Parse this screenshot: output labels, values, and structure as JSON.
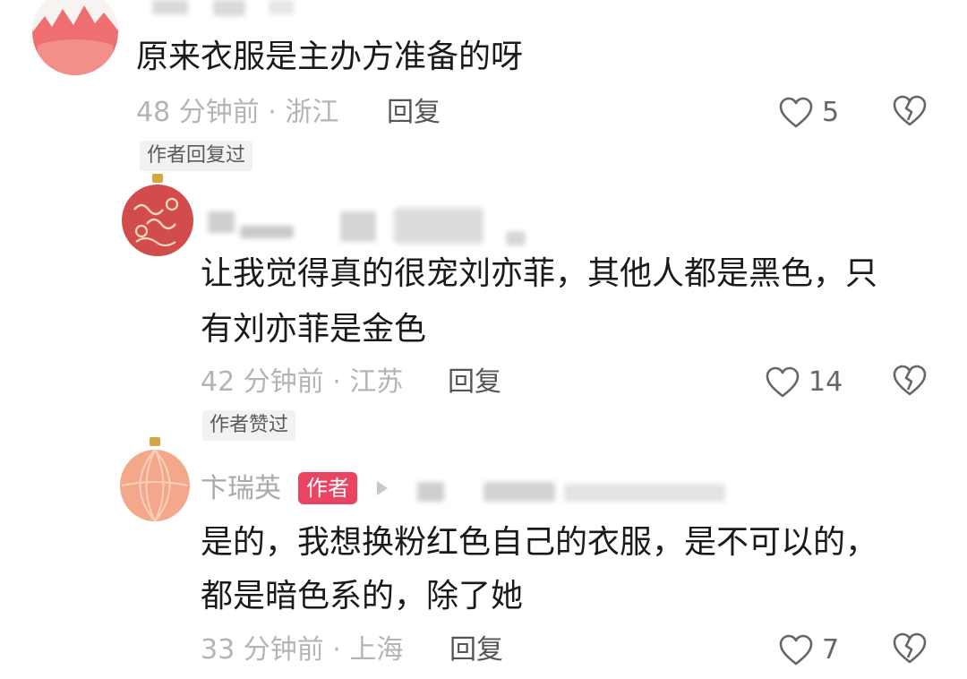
{
  "comments": [
    {
      "text": "原来衣服是主办方准备的呀",
      "time": "48 分钟前",
      "location": "浙江",
      "reply_label": "回复",
      "likes": "5",
      "tag": "作者回复过"
    },
    {
      "text_line1": "让我觉得真的很宠刘亦菲，其他人都是黑色，只",
      "text_line2": "有刘亦菲是金色",
      "time": "42 分钟前",
      "location": "江苏",
      "reply_label": "回复",
      "likes": "14",
      "tag": "作者赞过"
    },
    {
      "username": "卞瑞英",
      "badge": "作者",
      "text_line1": "是的，我想换粉红色自己的衣服，是不可以的，",
      "text_line2": "都是暗色系的，除了她",
      "time": "33 分钟前",
      "location": "上海",
      "reply_label": "回复",
      "likes": "7"
    }
  ],
  "separator": "·",
  "icons": {
    "like": "heart-outline-icon",
    "dislike": "broken-heart-icon",
    "reply_arrow": "reply-arrow-icon"
  },
  "colors": {
    "author_badge": "#e94560",
    "meta_text": "#b4b4b4",
    "tag_bg": "#f2f2f2"
  }
}
